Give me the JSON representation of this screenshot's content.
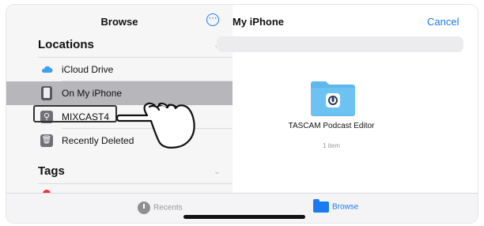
{
  "sidebar": {
    "title": "Browse",
    "locations_header": "Locations",
    "tags_header": "Tags",
    "items": [
      {
        "label": "iCloud Drive",
        "icon": "cloud-icon"
      },
      {
        "label": "On My iPhone",
        "icon": "phone-icon",
        "selected": true
      },
      {
        "label": "MIXCAST4",
        "icon": "usb-icon"
      },
      {
        "label": "Recently Deleted",
        "icon": "trash-icon"
      }
    ]
  },
  "main": {
    "title": "My iPhone",
    "cancel_label": "Cancel",
    "folder": {
      "name": "TASCAM Podcast Editor",
      "count": "1 item",
      "icon": "folder-icon",
      "color": "#5fb7ea"
    }
  },
  "tabbar": {
    "recents_label": "Recents",
    "browse_label": "Browse"
  },
  "colors": {
    "accent": "#1a7bf0",
    "selected_row": "#b7b7bb"
  }
}
